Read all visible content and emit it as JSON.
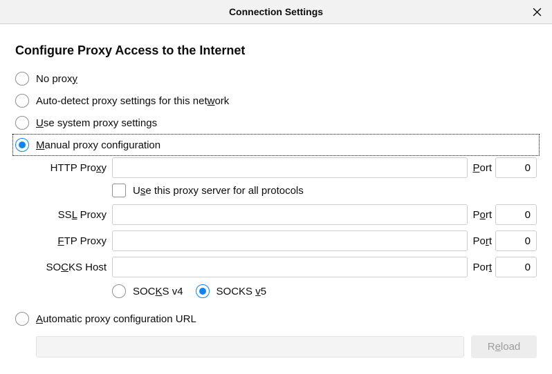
{
  "titlebar": {
    "title": "Connection Settings"
  },
  "heading": "Configure Proxy Access to the Internet",
  "radios": {
    "no_proxy_label_pre": "No prox",
    "no_proxy_label_ul": "y",
    "auto_detect_label_pre": "Auto-detect proxy settings for this net",
    "auto_detect_label_ul": "w",
    "auto_detect_label_post": "ork",
    "use_system_ul": "U",
    "use_system_post": "se system proxy settings",
    "manual_ul": "M",
    "manual_post": "anual proxy configuration",
    "auto_url_ul": "A",
    "auto_url_post": "utomatic proxy configuration URL"
  },
  "manual": {
    "http": {
      "label_pre": "HTTP Pro",
      "label_ul": "x",
      "label_post": "y",
      "value": "",
      "port_label_ul": "P",
      "port_label_post": "ort",
      "port_value": "0"
    },
    "use_all": {
      "label_pre": "U",
      "label_ul": "s",
      "label_post": "e this proxy server for all protocols"
    },
    "ssl": {
      "label_pre": "SS",
      "label_ul": "L",
      "label_post": " Proxy",
      "value": "",
      "port_label_pre": "P",
      "port_label_ul": "o",
      "port_label_post": "rt",
      "port_value": "0"
    },
    "ftp": {
      "label_ul": "F",
      "label_post": "TP Proxy",
      "value": "",
      "port_label_pre": "Po",
      "port_label_ul": "r",
      "port_label_post": "t",
      "port_value": "0"
    },
    "socks": {
      "label_pre": "SO",
      "label_ul": "C",
      "label_post": "KS Host",
      "value": "",
      "port_label_pre": "Por",
      "port_label_ul": "t",
      "port_value": "0"
    },
    "socks_ver": {
      "v4_pre": "SOC",
      "v4_ul": "K",
      "v4_post": "S v4",
      "v5_pre": "SOCKS ",
      "v5_ul": "v",
      "v5_post": "5"
    }
  },
  "auto_url": {
    "value": "",
    "reload_pre": "R",
    "reload_ul": "e",
    "reload_post": "load"
  }
}
